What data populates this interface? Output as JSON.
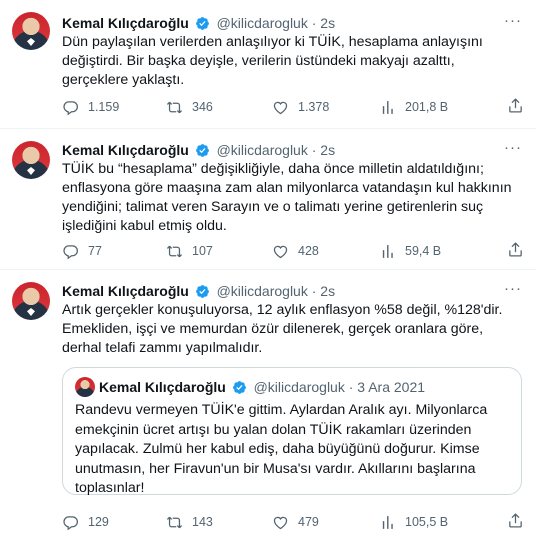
{
  "tweets": [
    {
      "name": "Kemal Kılıçdaroğlu",
      "handle": "@kilicdarogluk",
      "sep": "·",
      "time": "2s",
      "more": "···",
      "text": "Dün paylaşılan verilerden anlaşılıyor ki TÜİK, hesaplama anlayışını değiştirdi. Bir başka deyişle, verilerin üstündeki makyajı azalttı, gerçeklere yaklaştı.",
      "replies": "1.159",
      "retweets": "346",
      "likes": "1.378",
      "views": "201,8 B"
    },
    {
      "name": "Kemal Kılıçdaroğlu",
      "handle": "@kilicdarogluk",
      "sep": "·",
      "time": "2s",
      "more": "···",
      "text": "TÜİK bu “hesaplama” değişikliğiyle, daha önce milletin aldatıldığını; enflasyona göre maaşına zam alan milyonlarca vatandaşın kul hakkının yendiğini; talimat veren Sarayın ve o talimatı yerine getirenlerin suç işlediğini kabul etmiş oldu.",
      "replies": "77",
      "retweets": "107",
      "likes": "428",
      "views": "59,4 B"
    },
    {
      "name": "Kemal Kılıçdaroğlu",
      "handle": "@kilicdarogluk",
      "sep": "·",
      "time": "2s",
      "more": "···",
      "text": "Artık gerçekler konuşuluyorsa, 12 aylık enflasyon %58 değil, %128'dir. Emekliden, işçi ve memurdan özür dilenerek, gerçek oranlara göre, derhal telafi zammı yapılmalıdır.",
      "quote": {
        "name": "Kemal Kılıçdaroğlu",
        "handle": "@kilicdarogluk",
        "sep": "·",
        "time": "3 Ara 2021",
        "text": "Randevu vermeyen TÜİK'e gittim. Aylardan Aralık ayı. Milyonlarca emekçinin ücret artışı bu yalan dolan TÜİK rakamları üzerinden yapılacak. Zulmü her kabul ediş, daha büyüğünü doğurur. Kimse unutmasın, her Firavun'un bir Musa'sı vardır. Akıllarını başlarına toplasınlar!"
      },
      "replies": "129",
      "retweets": "143",
      "likes": "479",
      "views": "105,5 B"
    }
  ],
  "colors": {
    "verified": "#1d9bf0",
    "muted": "#536471",
    "text": "#0f1419",
    "border": "#cfd9de"
  },
  "icons": [
    "reply-icon",
    "retweet-icon",
    "like-icon",
    "views-icon",
    "share-icon",
    "verified-badge-icon",
    "more-icon"
  ]
}
